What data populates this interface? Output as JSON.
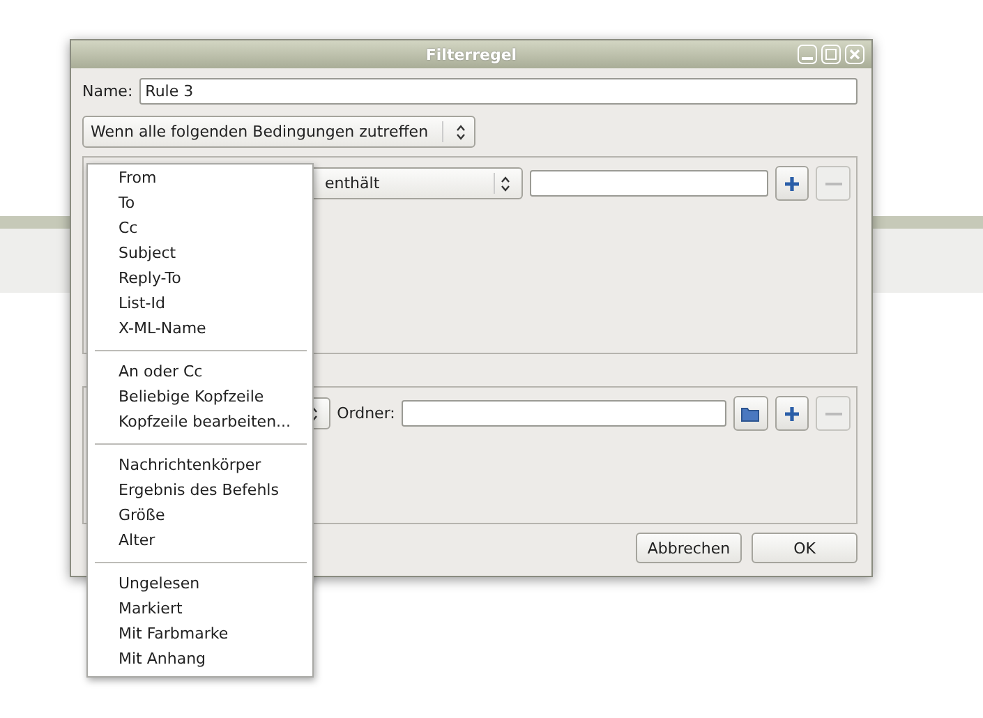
{
  "window": {
    "title": "Filterregel"
  },
  "name_field": {
    "label": "Name:",
    "value": "Rule 3"
  },
  "match_select": {
    "value": "Wenn alle folgenden Bedingungen zutreffen"
  },
  "condition": {
    "operator": "enthält"
  },
  "action": {
    "folder_label": "Ordner:"
  },
  "buttons": [
    "Abbrechen",
    "OK"
  ],
  "dropdown_menu": [
    [
      "From",
      "To",
      "Cc",
      "Subject",
      "Reply-To",
      "List-Id",
      "X-ML-Name"
    ],
    [
      "An oder Cc",
      "Beliebige Kopfzeile",
      "Kopfzeile bearbeiten..."
    ],
    [
      "Nachrichtenkörper",
      "Ergebnis des Befehls",
      "Größe",
      "Alter"
    ],
    [
      "Ungelesen",
      "Markiert",
      "Mit Farbmarke",
      "Mit Anhang"
    ]
  ]
}
